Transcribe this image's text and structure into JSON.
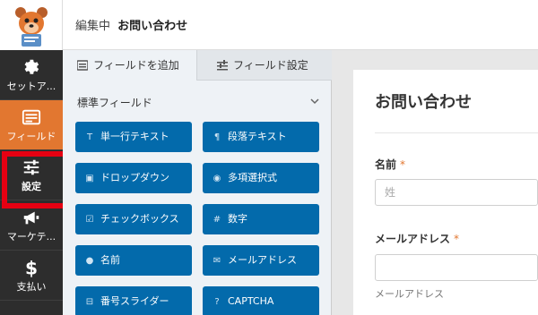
{
  "header": {
    "editing_label": "編集中",
    "form_name": "お問い合わせ"
  },
  "nav": {
    "items": [
      {
        "label": "セットア...",
        "icon": "gear-icon"
      },
      {
        "label": "フィールド",
        "icon": "fields-icon",
        "active": true
      },
      {
        "label": "設定",
        "icon": "sliders-icon",
        "highlighted": true
      },
      {
        "label": "マーケテ...",
        "icon": "megaphone-icon"
      },
      {
        "label": "支払い",
        "icon": "dollar-icon"
      }
    ]
  },
  "panel": {
    "tabs": [
      {
        "label": "フィールドを追加",
        "icon": "list-icon"
      },
      {
        "label": "フィールド設定",
        "icon": "sliders-icon"
      }
    ],
    "section_title": "標準フィールド",
    "buttons": [
      {
        "label": "単一行テキスト",
        "icon": "T"
      },
      {
        "label": "段落テキスト",
        "icon": "¶"
      },
      {
        "label": "ドロップダウン",
        "icon": "▣"
      },
      {
        "label": "多項選択式",
        "icon": "◉"
      },
      {
        "label": "チェックボックス",
        "icon": "☑"
      },
      {
        "label": "数字",
        "icon": "#"
      },
      {
        "label": "名前",
        "icon": "●"
      },
      {
        "label": "メールアドレス",
        "icon": "✉"
      },
      {
        "label": "番号スライダー",
        "icon": "⊟"
      },
      {
        "label": "CAPTCHA",
        "icon": "?"
      }
    ]
  },
  "preview": {
    "title": "お問い合わせ",
    "fields": [
      {
        "label": "名前",
        "required": "*",
        "placeholder": "姓"
      },
      {
        "label": "メールアドレス",
        "required": "*",
        "placeholder": "",
        "sublabel": "メールアドレス"
      }
    ]
  },
  "colors": {
    "accent": "#e27730",
    "button": "#036aab",
    "nav_bg": "#2d2d2d",
    "highlight_box": "#e60012"
  }
}
